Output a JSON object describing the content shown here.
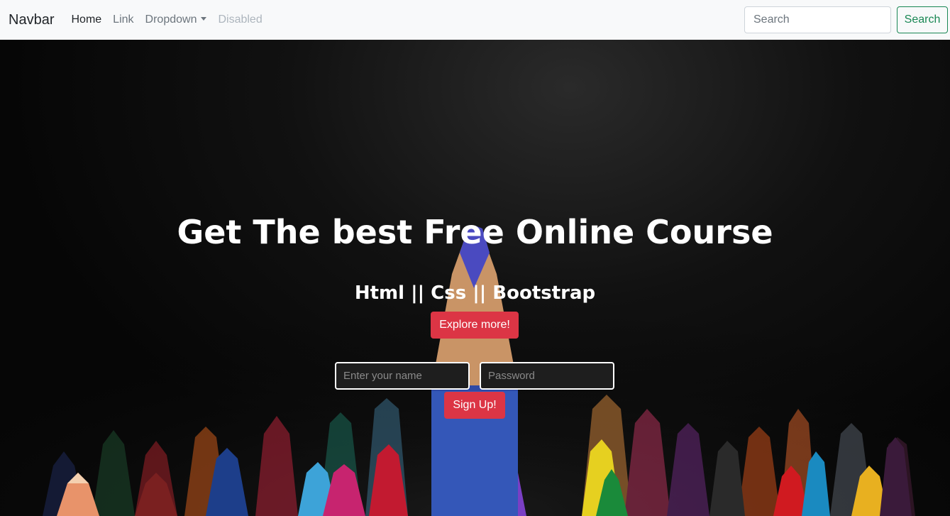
{
  "navbar": {
    "brand": "Navbar",
    "links": [
      {
        "label": "Home"
      },
      {
        "label": "Link"
      },
      {
        "label": "Dropdown"
      },
      {
        "label": "Disabled"
      }
    ],
    "search_placeholder": "Search",
    "search_button": "Search"
  },
  "hero": {
    "title": "Get The best Free Online Course",
    "subtitle": "Html || Css || Bootstrap",
    "explore_button": "Explore more!",
    "name_placeholder": "Enter your name",
    "password_placeholder": "Password",
    "signup_button": "Sign Up!"
  },
  "colors": {
    "navbar_bg": "#f8f9fa",
    "accent_red": "#dc3545",
    "outline_green": "#198754",
    "hero_bg": "#060606"
  }
}
